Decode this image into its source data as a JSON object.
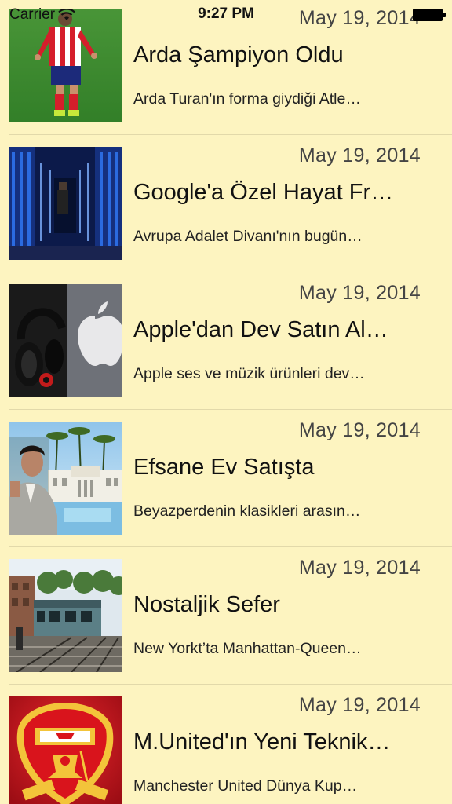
{
  "status_bar": {
    "carrier": "Carrier",
    "time": "9:27 PM",
    "wifi_icon": "wifi-icon",
    "battery_icon": "battery-icon"
  },
  "colors": {
    "background": "#fdf4c0",
    "separator": "#e2d9aa"
  },
  "news": [
    {
      "date": "May 19, 2014",
      "title": "Arda Şampiyon Oldu",
      "summary": "Arda Turan'ın forma giydiği Atle…",
      "thumbnail": "football-player-photo"
    },
    {
      "date": "May 19, 2014",
      "title": "Google'a Özel Hayat Fr…",
      "summary": "Avrupa Adalet Divanı'nın bugün…",
      "thumbnail": "data-center-photo"
    },
    {
      "date": "May 19, 2014",
      "title": "Apple'dan Dev Satın Al…",
      "summary": "Apple ses ve müzik ürünleri dev…",
      "thumbnail": "headphones-apple-logo-photo"
    },
    {
      "date": "May 19, 2014",
      "title": "Efsane Ev Satışta",
      "summary": "Beyazperdenin klasikleri arasın…",
      "thumbnail": "mansion-actor-photo"
    },
    {
      "date": "May 19, 2014",
      "title": "Nostaljik Sefer",
      "summary": "New Yorkt’ta Manhattan-Queen…",
      "thumbnail": "subway-train-photo"
    },
    {
      "date": "May 19, 2014",
      "title": "M.United'ın Yeni Teknik…",
      "summary": "Manchester United Dünya Kup…",
      "thumbnail": "manchester-united-crest-photo"
    }
  ]
}
